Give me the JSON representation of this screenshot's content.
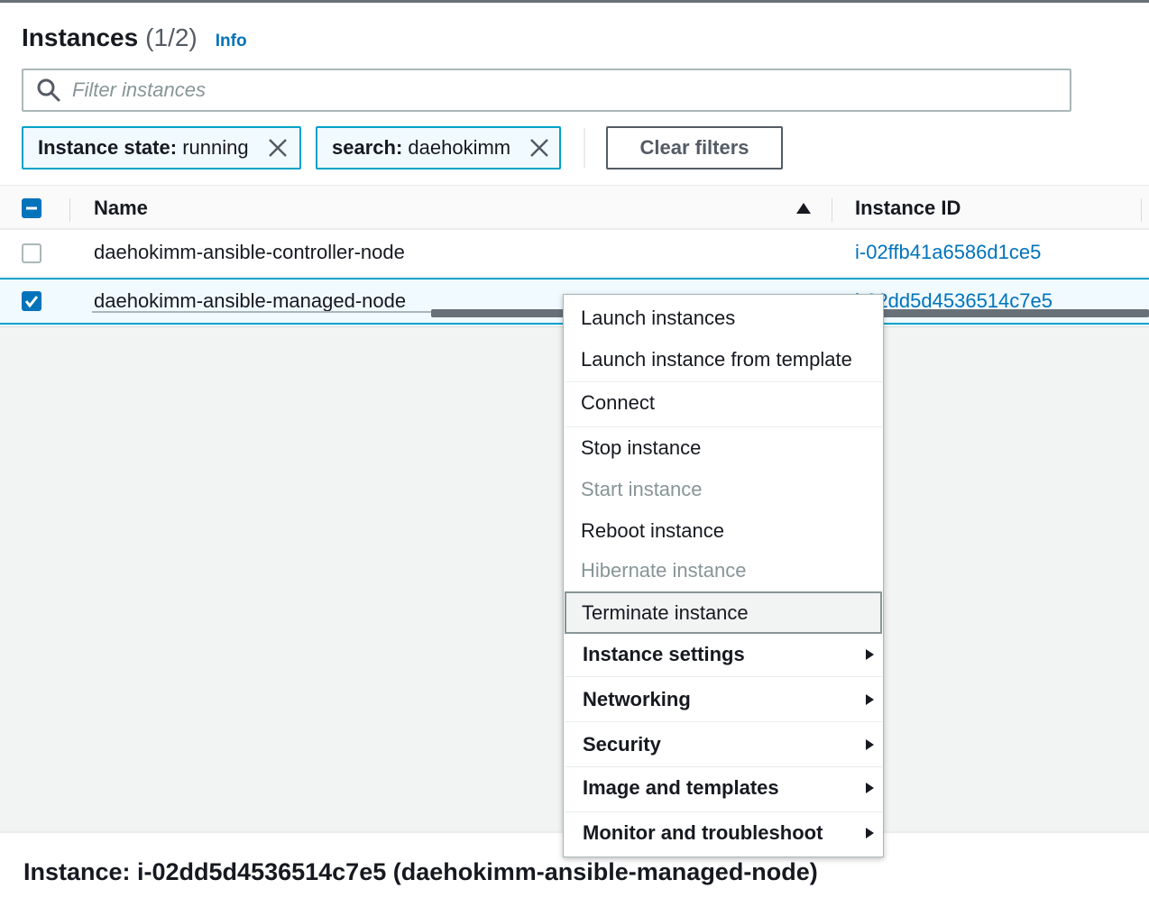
{
  "header": {
    "title": "Instances",
    "count": "(1/2)",
    "info_label": "Info"
  },
  "filter": {
    "placeholder": "Filter instances",
    "value": ""
  },
  "tokens": [
    {
      "key": "Instance state:",
      "value": "running"
    },
    {
      "key": "search:",
      "value": "daehokimm"
    }
  ],
  "clear_filters_label": "Clear filters",
  "table": {
    "columns": [
      "Name",
      "Instance ID"
    ],
    "rows": [
      {
        "name": "daehokimm-ansible-controller-node",
        "id": "i-02ffb41a6586d1ce5",
        "selected": false
      },
      {
        "name": "daehokimm-ansible-managed-node",
        "id": "i-02dd5d4536514c7e5",
        "selected": true
      }
    ]
  },
  "context_menu": {
    "items": [
      {
        "label": "Launch instances",
        "enabled": true
      },
      {
        "label": "Launch instance from template",
        "enabled": true
      },
      {
        "label": "Connect",
        "enabled": true
      },
      {
        "label": "Stop instance",
        "enabled": true
      },
      {
        "label": "Start instance",
        "enabled": false
      },
      {
        "label": "Reboot instance",
        "enabled": true
      },
      {
        "label": "Hibernate instance",
        "enabled": false
      },
      {
        "label": "Terminate instance",
        "enabled": true,
        "hovered": true
      },
      {
        "label": "Instance settings",
        "submenu": true
      },
      {
        "label": "Networking",
        "submenu": true
      },
      {
        "label": "Security",
        "submenu": true
      },
      {
        "label": "Image and templates",
        "submenu": true
      },
      {
        "label": "Monitor and troubleshoot",
        "submenu": true
      }
    ]
  },
  "details": {
    "title": "Instance: i-02dd5d4536514c7e5 (daehokimm-ansible-managed-node)"
  },
  "colors": {
    "accent": "#0073bb",
    "token_border": "#00a1c9",
    "text": "#16191f",
    "disabled": "#879596"
  }
}
